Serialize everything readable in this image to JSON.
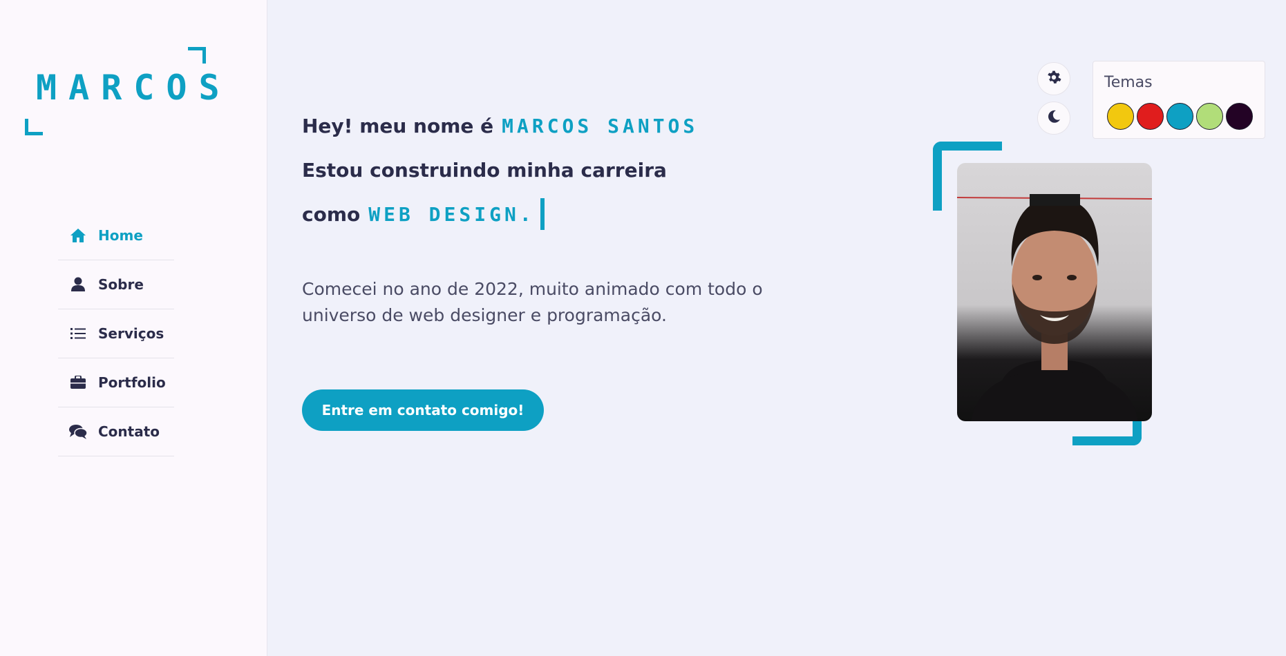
{
  "logo": {
    "text": "MARCOS"
  },
  "nav": {
    "items": [
      {
        "label": "Home",
        "icon": "home-icon",
        "active": true
      },
      {
        "label": "Sobre",
        "icon": "user-icon",
        "active": false
      },
      {
        "label": "Serviços",
        "icon": "list-icon",
        "active": false
      },
      {
        "label": "Portfolio",
        "icon": "briefcase-icon",
        "active": false
      },
      {
        "label": "Contato",
        "icon": "chat-icon",
        "active": false
      }
    ]
  },
  "hero": {
    "line1_prefix": "Hey! meu nome é",
    "line1_name": "MARCOS SANTOS",
    "line2": "Estou construindo minha carreira",
    "line3_prefix": "como",
    "line3_role": "WEB DESIGN.",
    "description": "Comecei no ano de 2022, muito animado com todo o universo de web designer e programação.",
    "cta_label": "Entre em contato comigo!"
  },
  "theme_panel": {
    "title": "Temas",
    "settings_icon": "gear-icon",
    "mode_icon": "moon-icon",
    "swatches": [
      "#f2c80f",
      "#e01d1d",
      "#0ea0c3",
      "#b1dd79",
      "#230325"
    ]
  },
  "colors": {
    "accent": "#0ea0c3",
    "text": "#2b2c4a",
    "background": "#f0f1fa",
    "sidebar": "#fcf8fd"
  }
}
